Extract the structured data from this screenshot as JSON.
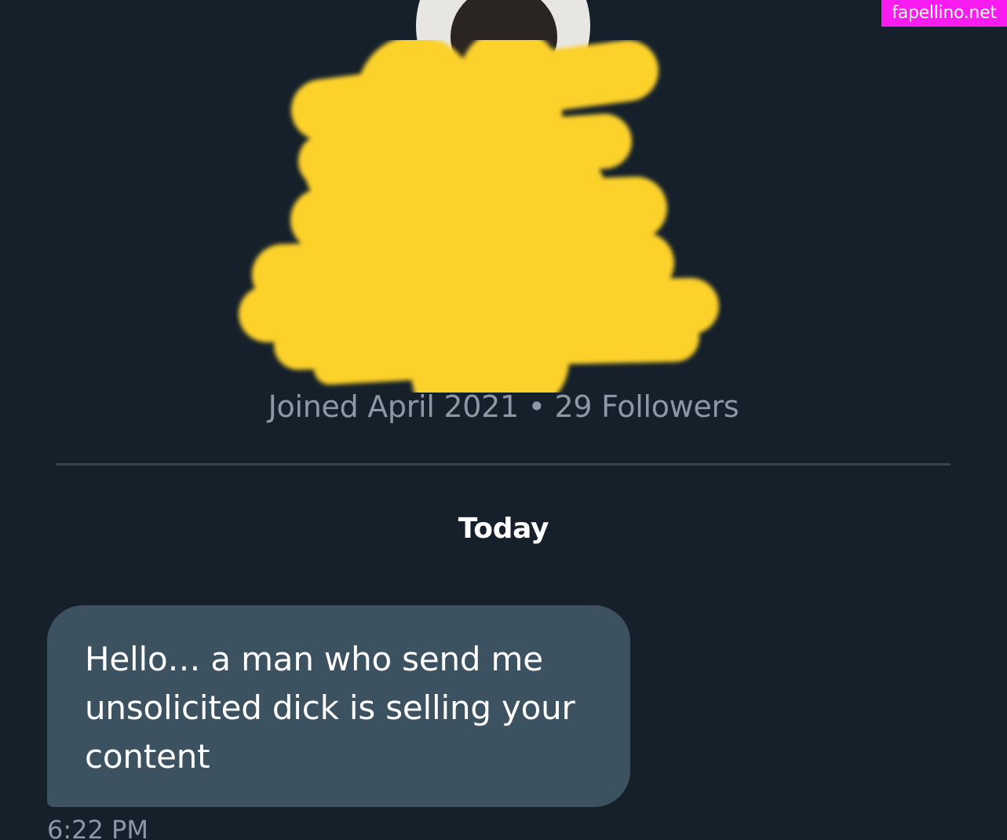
{
  "watermark": "fapellino.net",
  "profile": {
    "meta": "Joined April 2021 • 29 Followers"
  },
  "conversation": {
    "date_separator": "Today",
    "messages": [
      {
        "text": "Hello… a man who send me unsolicited dick is selling your content",
        "time": "6:22 PM"
      }
    ]
  },
  "colors": {
    "background": "#15202b",
    "bubble": "#3d5260",
    "muted_text": "#8b98a5",
    "divider": "#38444d",
    "redaction": "#fcd12a",
    "watermark_bg": "#f91cf1"
  },
  "icons": {
    "avatar": "profile-avatar",
    "redaction": "yellow-scribble-redaction"
  }
}
